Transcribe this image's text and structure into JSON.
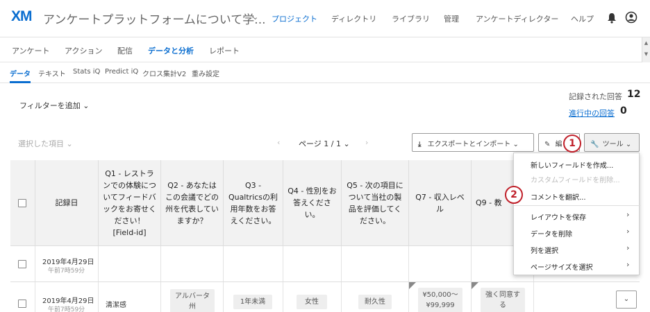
{
  "header": {
    "logo": "XM",
    "survey_title": "アンケートプラットフォームについて学...",
    "nav": [
      "プロジェクト",
      "ディレクトリ",
      "ライブラリ",
      "管理",
      "アンケートディレクター",
      "ヘルプ"
    ],
    "active_nav": "プロジェクト"
  },
  "subnav": {
    "items": [
      "アンケート",
      "アクション",
      "配信",
      "データと分析",
      "レポート"
    ],
    "active": "データと分析"
  },
  "tabs": {
    "items": [
      "データ",
      "テキスト",
      "Stats iQ",
      "Predict iQ",
      "クロス集計V2",
      "重み設定"
    ],
    "active": "データ"
  },
  "filter": {
    "label": "フィルターを追加"
  },
  "stats": {
    "recorded_label": "記録された回答",
    "recorded_value": "12",
    "inprogress_label": "進行中の回答",
    "inprogress_value": "0"
  },
  "toolbar": {
    "selected_items": "選択した項目",
    "page_label": "ページ 1 / 1",
    "export_button": "エクスポートとインポート",
    "edit_button": "編",
    "tools_button": "ツール"
  },
  "table": {
    "columns": {
      "date": "記録日",
      "q1": "Q1 - レストランでの体験についてフィードバックをお寄せください！ [Field-id]",
      "q2": "Q2 - あなたはこの会議でどの州を代表していますか？",
      "q3": "Q3 - Qualtricsの利用年数をお答えください。",
      "q4": "Q4 - 性別をお答えください。",
      "q5": "Q5 - 次の項目について当社の製品を評価してください。",
      "q7": "Q7 - 収入レベル",
      "q9": "Q9 - 教"
    },
    "rows": [
      {
        "date": "2019年4月29日",
        "time": "午前7時59分"
      },
      {
        "date": "2019年4月29日",
        "time": "午前7時59分",
        "q1": "清潔感",
        "q2": "アルバータ州",
        "q3": "1年未満",
        "q4": "女性",
        "q5": "耐久性",
        "q7": "¥50,000〜¥99,999",
        "q9": "強く同意する"
      }
    ]
  },
  "tools_menu": {
    "items": [
      {
        "label": "新しいフィールドを作成...",
        "disabled": false
      },
      {
        "label": "カスタムフィールドを削除...",
        "disabled": true
      },
      {
        "label": "コメントを翻訳...",
        "disabled": false
      }
    ],
    "submenus": [
      "レイアウトを保存",
      "データを削除",
      "列を選択",
      "ページサイズを選択"
    ]
  },
  "callouts": [
    "1",
    "2"
  ],
  "colors": {
    "accent": "#0b6ed0",
    "callout": "#c0202a"
  }
}
